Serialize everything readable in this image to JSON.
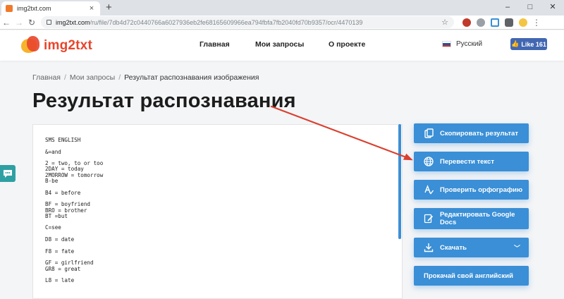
{
  "browser": {
    "tab_title": "img2txt.com",
    "tab_close": "×",
    "new_tab": "+",
    "window_controls": [
      "–",
      "□",
      "✕"
    ],
    "url_host": "img2txt.com",
    "url_path": "/ru/file/7db4d72c0440766a6027936eb2fe68165609966ea794fbfa7fb2040fd70b9357/ocr/4470139"
  },
  "header": {
    "logo_text": "img2txt",
    "nav": [
      "Главная",
      "Мои запросы",
      "О проекте"
    ],
    "language": "Русский",
    "like_label": "Like 161"
  },
  "breadcrumb": {
    "home": "Главная",
    "requests": "Мои запросы",
    "current": "Результат распознавания изображения"
  },
  "page_title": "Результат распознавания",
  "result_text": "SMS ENGLISH\n\n&=and\n\n2 = two, to or too\n2DAY = today\n2MORROW = tomorrow\nB-be\n\nB4 = before\n\nBF = boyfriend\nBRO = brother\nBT =but\n\nC=see\n\nD8 = date\n\nF8 = fate\n\nGF = girlfriend\nGR8 = great\n\nL8 = late",
  "actions": {
    "copy": "Скопировать результат",
    "translate": "Перевести текст",
    "spellcheck": "Проверить орфографию",
    "google_docs": "Редактировать Google Docs",
    "download": "Скачать",
    "english": "Прокачай свой английский"
  },
  "colors": {
    "accent_blue": "#3a8fd6",
    "brand_red": "#e8452c",
    "annotation_arrow": "#d9402f"
  }
}
